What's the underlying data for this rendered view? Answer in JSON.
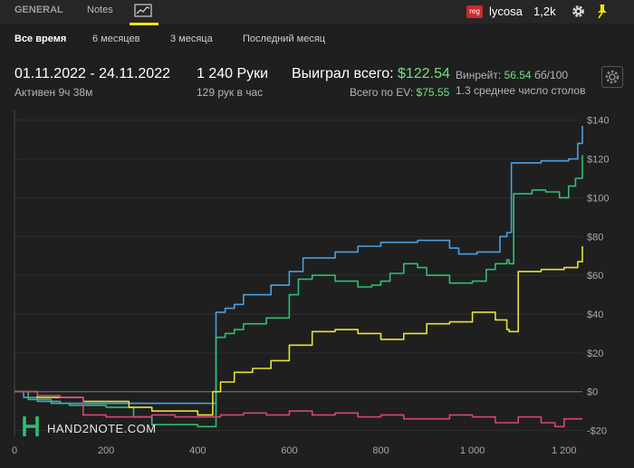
{
  "tabs": {
    "general": "GENERAL",
    "notes": "Notes",
    "graph_icon": "chart-line-icon"
  },
  "header_right": {
    "badge": "reg",
    "username": "lycosa",
    "stack": "1,2k",
    "gear_icon": "gear-icon",
    "pin_icon": "pin-icon"
  },
  "periods": [
    "Все время",
    "6 месяцев",
    "3 месяца",
    "Последний месяц"
  ],
  "stats": {
    "date_range": "01.11.2022 - 24.11.2022",
    "active": "Активен 9ч 38м",
    "hands": "1 240 Руки",
    "hands_per_hour": "129 рук в час",
    "won_label": "Выиграл всего:",
    "won_value": "$122.54",
    "ev_label": "Всего по EV:",
    "ev_value": "$75.55",
    "winrate_label": "Винрейт:",
    "winrate_value": "56.54",
    "winrate_unit": "бб/100",
    "tables": "1.3 среднее число столов"
  },
  "watermark": "HAND2NOTE.COM",
  "colors": {
    "blue": "#4a9fe0",
    "green": "#2fbf72",
    "yellow": "#e6e23a",
    "pink": "#d6457a",
    "accent": "#f2e600",
    "won": "#6fe27a"
  },
  "chart_data": {
    "type": "line",
    "xlim": [
      0,
      1240
    ],
    "ylim": [
      -23,
      145
    ],
    "x_ticks": [
      0,
      200,
      400,
      600,
      800,
      1000,
      1200
    ],
    "x_tick_labels": [
      "0",
      "200",
      "400",
      "600",
      "800",
      "1 000",
      "1 200"
    ],
    "y_ticks": [
      -20,
      0,
      20,
      40,
      60,
      80,
      100,
      120,
      140
    ],
    "y_tick_labels": [
      "-$20",
      "$0",
      "$20",
      "$40",
      "$60",
      "$80",
      "$100",
      "$120",
      "$140"
    ],
    "series": [
      {
        "color": "#4a9fe0",
        "x": [
          0,
          20,
          50,
          100,
          200,
          300,
          433,
          440,
          460,
          480,
          500,
          560,
          600,
          630,
          700,
          750,
          800,
          850,
          880,
          900,
          950,
          970,
          1010,
          1060,
          1075,
          1085,
          1150,
          1210,
          1230,
          1240
        ],
        "y": [
          0,
          -3,
          -5,
          -6,
          -6,
          -6,
          -6,
          41,
          43,
          45,
          50,
          55,
          62,
          69,
          72,
          75,
          77,
          77,
          78,
          78,
          74,
          71,
          72,
          80,
          82,
          118,
          119,
          120,
          128,
          137
        ]
      },
      {
        "color": "#2fbf72",
        "x": [
          0,
          30,
          80,
          120,
          200,
          260,
          300,
          400,
          433,
          440,
          460,
          480,
          500,
          550,
          600,
          620,
          650,
          700,
          750,
          780,
          800,
          820,
          850,
          880,
          900,
          950,
          1000,
          1030,
          1050,
          1075,
          1080,
          1090,
          1130,
          1160,
          1190,
          1210,
          1225,
          1240
        ],
        "y": [
          0,
          -4,
          -6,
          -7,
          -8,
          -13,
          -17,
          -18,
          -18,
          28,
          30,
          32,
          35,
          38,
          50,
          58,
          60,
          57,
          54,
          55,
          57,
          61,
          66,
          64,
          60,
          56,
          57,
          63,
          66,
          68,
          66,
          102,
          104,
          103,
          100,
          106,
          110,
          122
        ]
      },
      {
        "color": "#e6e23a",
        "x": [
          0,
          50,
          150,
          250,
          300,
          400,
          433,
          450,
          480,
          520,
          560,
          600,
          650,
          700,
          750,
          800,
          850,
          900,
          950,
          1000,
          1050,
          1075,
          1080,
          1100,
          1150,
          1200,
          1230,
          1240
        ],
        "y": [
          0,
          -3,
          -5,
          -8,
          -10,
          -12,
          0,
          5,
          10,
          12,
          16,
          24,
          31,
          32,
          30,
          27,
          30,
          35,
          36,
          41,
          37,
          32,
          31,
          62,
          63,
          64,
          67,
          75
        ]
      },
      {
        "color": "#d6457a",
        "x": [
          0,
          50,
          100,
          150,
          200,
          250,
          300,
          350,
          400,
          433,
          450,
          500,
          550,
          600,
          650,
          700,
          750,
          800,
          850,
          900,
          950,
          1000,
          1050,
          1100,
          1150,
          1180,
          1200,
          1240
        ],
        "y": [
          0,
          -2,
          -3,
          -12,
          -13,
          -13,
          -12,
          -13,
          -13,
          -13,
          -12,
          -11,
          -12,
          -10,
          -12,
          -11,
          -13,
          -12,
          -14,
          -14,
          -12,
          -13,
          -16,
          -13,
          -16,
          -18,
          -14,
          -14
        ]
      }
    ]
  }
}
